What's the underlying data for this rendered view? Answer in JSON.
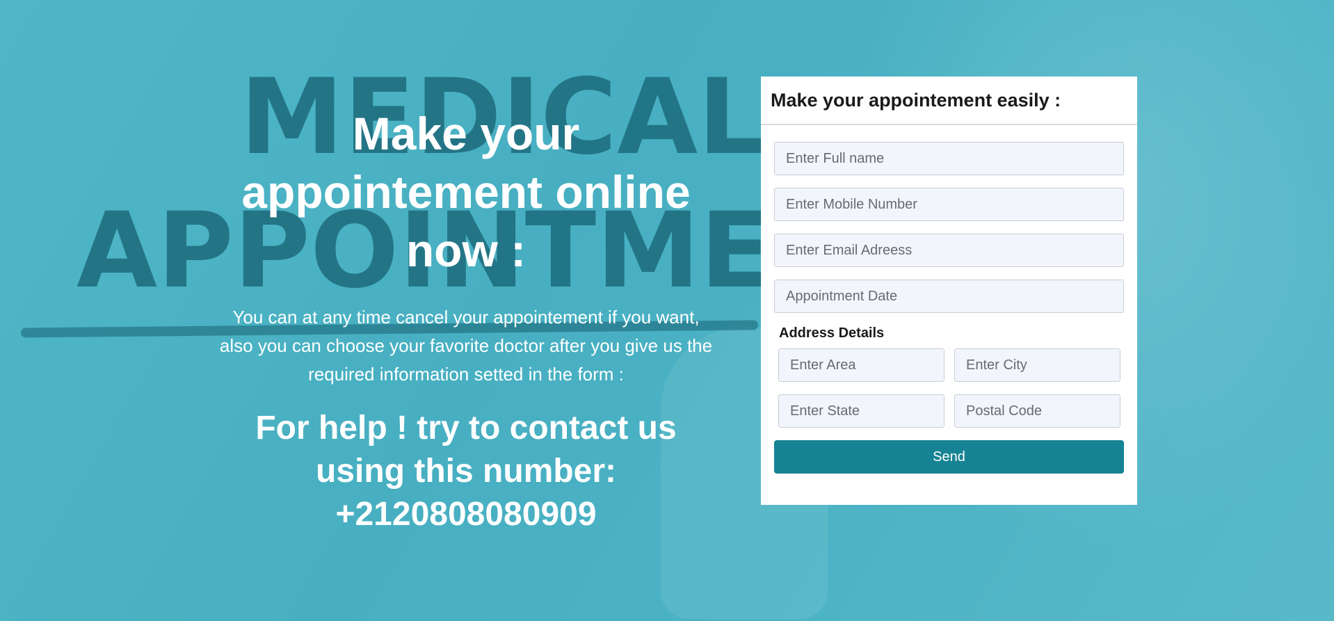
{
  "background": {
    "watermark_line1": "MEDICAL",
    "watermark_line2": "APPOINTME"
  },
  "hero": {
    "title": "Make your appointement online now :",
    "description": "You can at any time cancel your appointement if you want, also you can choose your favorite doctor after you give us the required information setted in the form :",
    "help": "For help ! try to contact us using this number: +2120808080909"
  },
  "form": {
    "title": "Make your appointement easily :",
    "full_name_placeholder": "Enter Full name",
    "mobile_placeholder": "Enter Mobile Number",
    "email_placeholder": "Enter Email Adreess",
    "date_placeholder": "Appointment Date",
    "address_label": "Address Details",
    "area_placeholder": "Enter Area",
    "city_placeholder": "Enter City",
    "state_placeholder": "Enter State",
    "postal_placeholder": "Postal Code",
    "send_label": "Send"
  },
  "colors": {
    "background": "#4bb3c5",
    "watermark": "#1f6f80",
    "button": "#168394",
    "input_bg": "#f3f5fc"
  }
}
